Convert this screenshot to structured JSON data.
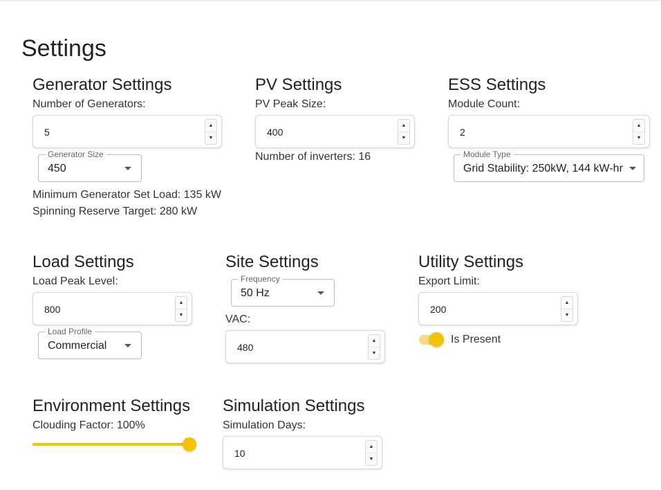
{
  "page": {
    "title": "Settings"
  },
  "generator": {
    "title": "Generator Settings",
    "count_label": "Number of Generators:",
    "count_value": "5",
    "size_legend": "Generator Size",
    "size_value": "450",
    "min_load": "Minimum Generator Set Load: 135 kW",
    "spinning_reserve": "Spinning Reserve Target: 280 kW"
  },
  "pv": {
    "title": "PV Settings",
    "peak_label": "PV Peak Size:",
    "peak_value": "400",
    "inverters": "Number of inverters: 16"
  },
  "ess": {
    "title": "ESS Settings",
    "module_count_label": "Module Count:",
    "module_count_value": "2",
    "module_type_legend": "Module Type",
    "module_type_value": "Grid Stability: 250kW, 144 kW-hr"
  },
  "load": {
    "title": "Load Settings",
    "peak_label": "Load Peak Level:",
    "peak_value": "800",
    "profile_legend": "Load Profile",
    "profile_value": "Commercial"
  },
  "site": {
    "title": "Site Settings",
    "frequency_legend": "Frequency",
    "frequency_value": "50 Hz",
    "vac_label": "VAC:",
    "vac_value": "480"
  },
  "utility": {
    "title": "Utility Settings",
    "export_label": "Export Limit:",
    "export_value": "200",
    "present_label": "Is Present",
    "present_on": true
  },
  "environment": {
    "title": "Environment Settings",
    "clouding_label": "Clouding Factor: 100%",
    "clouding_value": 1.0
  },
  "simulation": {
    "title": "Simulation Settings",
    "days_label": "Simulation Days:",
    "days_value": "10"
  },
  "colors": {
    "accent": "#f5c400",
    "accent_light": "#f6dc7e"
  },
  "icons": {
    "spinner_up": "▲",
    "spinner_down": "▼",
    "dropdown": "caret-down"
  }
}
